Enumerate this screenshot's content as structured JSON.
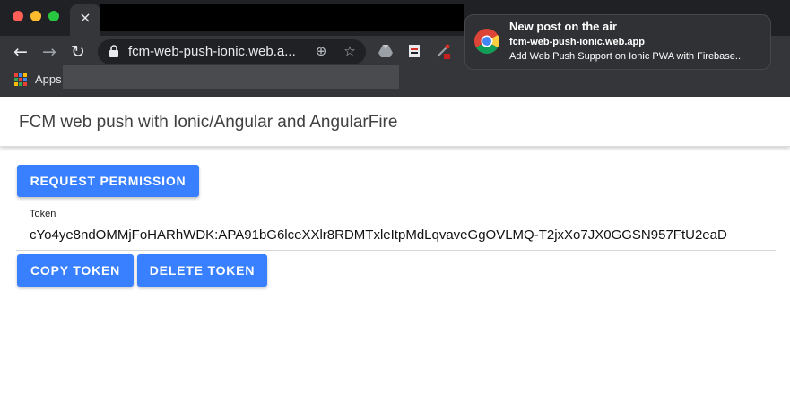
{
  "browser": {
    "url": "fcm-web-push-ionic.web.a...",
    "tab_close": "×",
    "bookmarks": {
      "apps_label": "Apps"
    },
    "colors": {
      "close": "#ff5f57",
      "minimize": "#febc2e",
      "maximize": "#28c840"
    },
    "icons": [
      "back-arrow-icon",
      "forward-arrow-icon",
      "reload-icon",
      "lock-icon",
      "add-site-icon",
      "star-icon",
      "drive-icon",
      "extension-icon",
      "eyedropper-icon",
      "apps-grid-icon"
    ]
  },
  "notification": {
    "title": "New post on the air",
    "site": "fcm-web-push-ionic.web.app",
    "body": "Add Web Push Support on Ionic PWA with Firebase..."
  },
  "app": {
    "title": "FCM web push with Ionic/Angular and AngularFire",
    "request_permission": "REQUEST PERMISSION",
    "token_label": "Token",
    "token_value": "cYo4ye8ndOMMjFoHARhWDK:APA91bG6lceXXlr8RDMTxleItpMdLqvaveGgOVLMQ-T2jxXo7JX0GGSN957FtU2eaD",
    "copy_token": "COPY TOKEN",
    "delete_token": "DELETE TOKEN",
    "accent_color": "#3880ff"
  }
}
